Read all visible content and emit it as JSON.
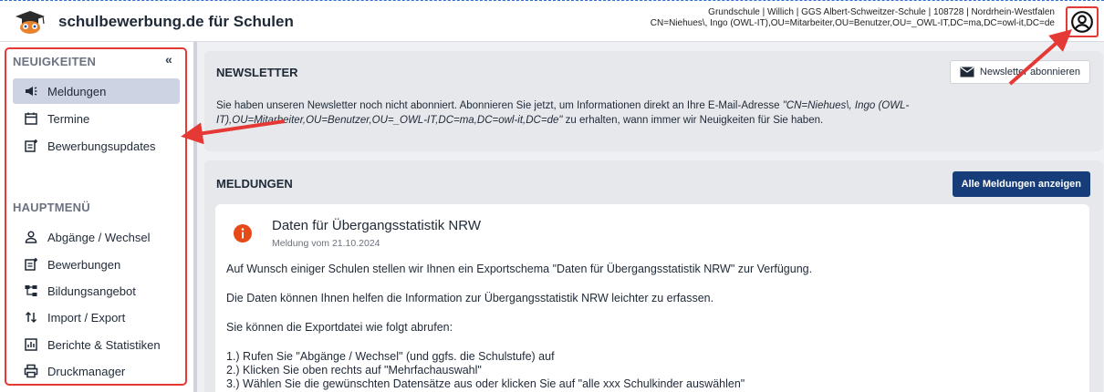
{
  "header": {
    "app_title": "schulbewerbung.de für Schulen",
    "context_line1": "Grundschule | Willich | GGS Albert-Schweitzer-Schule | 108728 | Nordrhein-Westfalen",
    "context_line2": "CN=Niehues\\, Ingo (OWL-IT),OU=Mitarbeiter,OU=Benutzer,OU=_OWL-IT,DC=ma,DC=owl-it,DC=de"
  },
  "sidebar": {
    "news_heading": "NEUIGKEITEN",
    "collapse_label": "«",
    "news_items": [
      {
        "label": "Meldungen",
        "icon": "megaphone-icon",
        "active": true
      },
      {
        "label": "Termine",
        "icon": "calendar-icon"
      },
      {
        "label": "Bewerbungsupdates",
        "icon": "post-add-icon"
      }
    ],
    "main_heading": "HAUPTMENÜ",
    "main_items": [
      {
        "label": "Abgänge / Wechsel",
        "icon": "person-icon"
      },
      {
        "label": "Bewerbungen",
        "icon": "post-add-icon"
      },
      {
        "label": "Bildungsangebot",
        "icon": "hierarchy-icon"
      },
      {
        "label": "Import / Export",
        "icon": "import-export-icon"
      },
      {
        "label": "Berichte & Statistiken",
        "icon": "bar-chart-icon"
      },
      {
        "label": "Druckmanager",
        "icon": "printer-icon"
      }
    ]
  },
  "newsletter": {
    "title": "NEWSLETTER",
    "subscribe_label": "Newsletter abonnieren",
    "text_before": "Sie haben unseren Newsletter noch nicht abonniert. Abonnieren Sie jetzt, um Informationen direkt an Ihre E-Mail-Adresse ",
    "text_address": "\"CN=Niehues\\, Ingo (OWL-IT),OU=Mitarbeiter,OU=Benutzer,OU=_OWL-IT,DC=ma,DC=owl-it,DC=de\"",
    "text_after": " zu erhalten, wann immer wir Neuigkeiten für Sie haben."
  },
  "news": {
    "title": "MELDUNGEN",
    "show_all_label": "Alle Meldungen anzeigen",
    "message": {
      "title": "Daten für Übergangsstatistik NRW",
      "date": "Meldung vom 21.10.2024",
      "paragraphs": [
        "Auf Wunsch einiger Schulen stellen wir Ihnen ein Exportschema \"Daten für Übergangsstatistik NRW\" zur Verfügung.",
        "Die Daten können Ihnen helfen die Information zur Übergangsstatistik NRW leichter zu erfassen.",
        "Sie können die Exportdatei wie folgt abrufen:",
        "1.) Rufen Sie \"Abgänge / Wechsel\" (und ggfs. die Schulstufe) auf",
        "2.) Klicken Sie oben rechts auf \"Mehrfachauswahl\"",
        "3.) Wählen Sie die gewünschten Datensätze aus oder klicken Sie auf \"alle xxx Schulkinder auswählen\""
      ]
    }
  },
  "colors": {
    "accent": "#173c7a",
    "annotation_red": "#e53935",
    "info_orange": "#e64a19",
    "active_bg": "#cdd3e3"
  }
}
